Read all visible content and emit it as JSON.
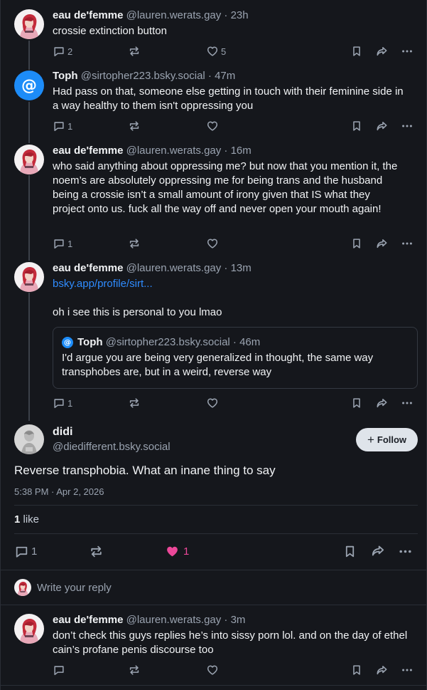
{
  "posts": [
    {
      "name": "eau de'femme",
      "handle": "@lauren.werats.gay",
      "time": "· 23h",
      "text": "crossie extinction button",
      "replies": "2",
      "likes": "5"
    },
    {
      "name": "Toph",
      "handle": "@sirtopher223.bsky.social",
      "time": "· 47m",
      "text": "Had pass on that, someone else getting in touch with their feminine side in a way healthy to them isn't oppressing you",
      "replies": "1"
    },
    {
      "name": "eau de'femme",
      "handle": "@lauren.werats.gay",
      "time": "· 16m",
      "text": "who said anything about oppressing me? but now that you mention it, the noem’s are absolutely oppressing me for being trans and the husband being a crossie isn’t a small amount of irony given that IS what they project onto us. fuck all the way off and never open your mouth again!",
      "replies": "1"
    },
    {
      "name": "eau de'femme",
      "handle": "@lauren.werats.gay",
      "time": "· 13m",
      "link": "bsky.app/profile/sirt...",
      "text": "oh i see this is personal to you lmao",
      "replies": "1",
      "quote": {
        "name": "Toph",
        "handle": "@sirtopher223.bsky.social",
        "time": "· 46m",
        "text": "I'd argue you are being very generalized in thought, the same way transphobes are, but in a weird, reverse way"
      }
    }
  ],
  "focused": {
    "name": "didi",
    "handle": "@diedifferent.bsky.social",
    "follow_label": "Follow",
    "text": "Reverse transphobia. What an inane thing to say",
    "timestamp": "5:38 PM · Apr 2, 2026",
    "likes_count": "1",
    "likes_label": "like",
    "replies": "1",
    "liked_count": "1"
  },
  "composer": {
    "placeholder": "Write your reply"
  },
  "reply": {
    "name": "eau de'femme",
    "handle": "@lauren.werats.gay",
    "time": "· 3m",
    "text": "don’t check this guys replies he’s into sissy porn lol. and on the day of ethel cain’s profane penis discourse too"
  },
  "colors": {
    "background": "#15171c",
    "link": "#2f8cff",
    "like_active": "#ec4899",
    "muted": "#9aa3b0"
  }
}
